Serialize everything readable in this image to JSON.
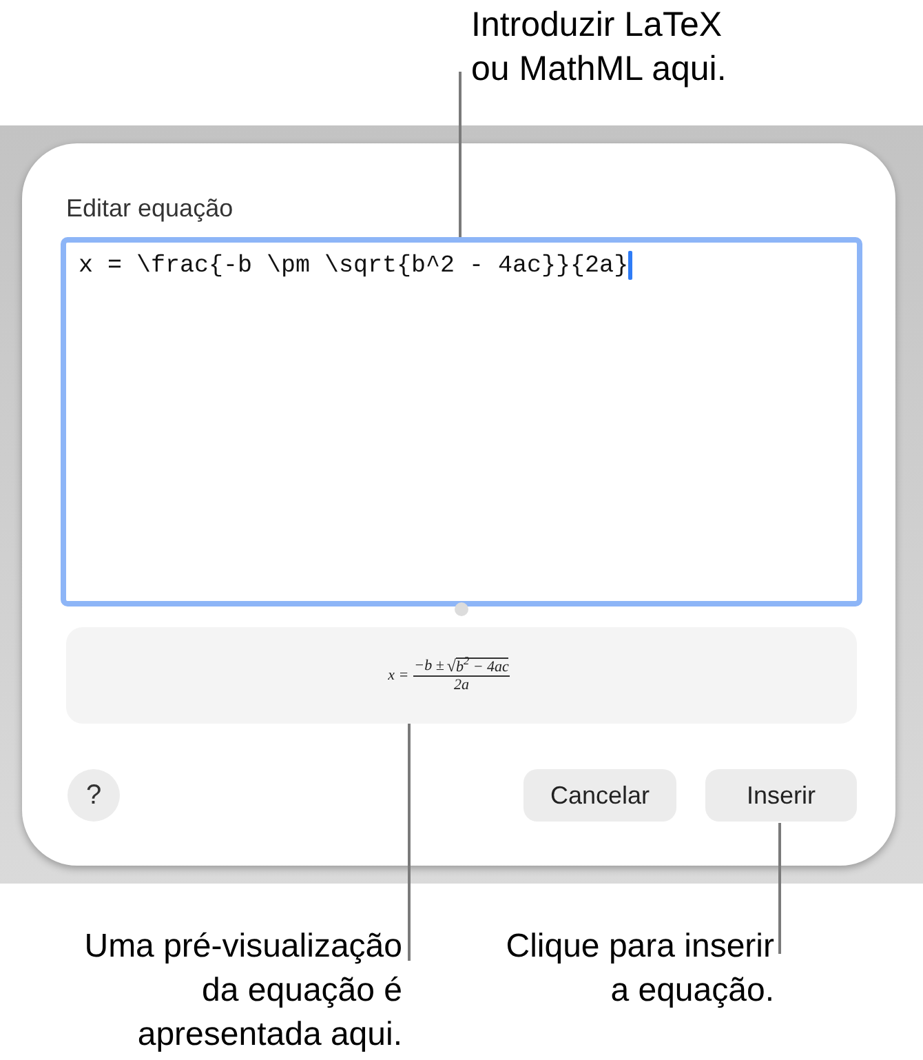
{
  "callouts": {
    "top": {
      "lines": [
        "Introduzir LaTeX",
        "ou MathML aqui."
      ]
    },
    "preview": {
      "lines": [
        "Uma pré-visualização",
        "da equação é",
        "apresentada aqui."
      ]
    },
    "insert": {
      "lines": [
        "Clique para inserir",
        "a equação."
      ]
    }
  },
  "dialog": {
    "title": "Editar equação",
    "editor": {
      "value": "x = \\frac{-b \\pm \\sqrt{b^2 - 4ac}}{2a}",
      "focused": true
    },
    "preview": {
      "lhs": "x =",
      "numerator": "−b ±",
      "radical": "√",
      "radicand": "b$^{2}$ − 4ac",
      "denominator": "2a"
    },
    "buttons": [
      {
        "label": "?",
        "kind": "help"
      },
      {
        "label": "Cancelar",
        "kind": "normal"
      },
      {
        "label": "Inserir",
        "kind": "normal"
      }
    ]
  }
}
